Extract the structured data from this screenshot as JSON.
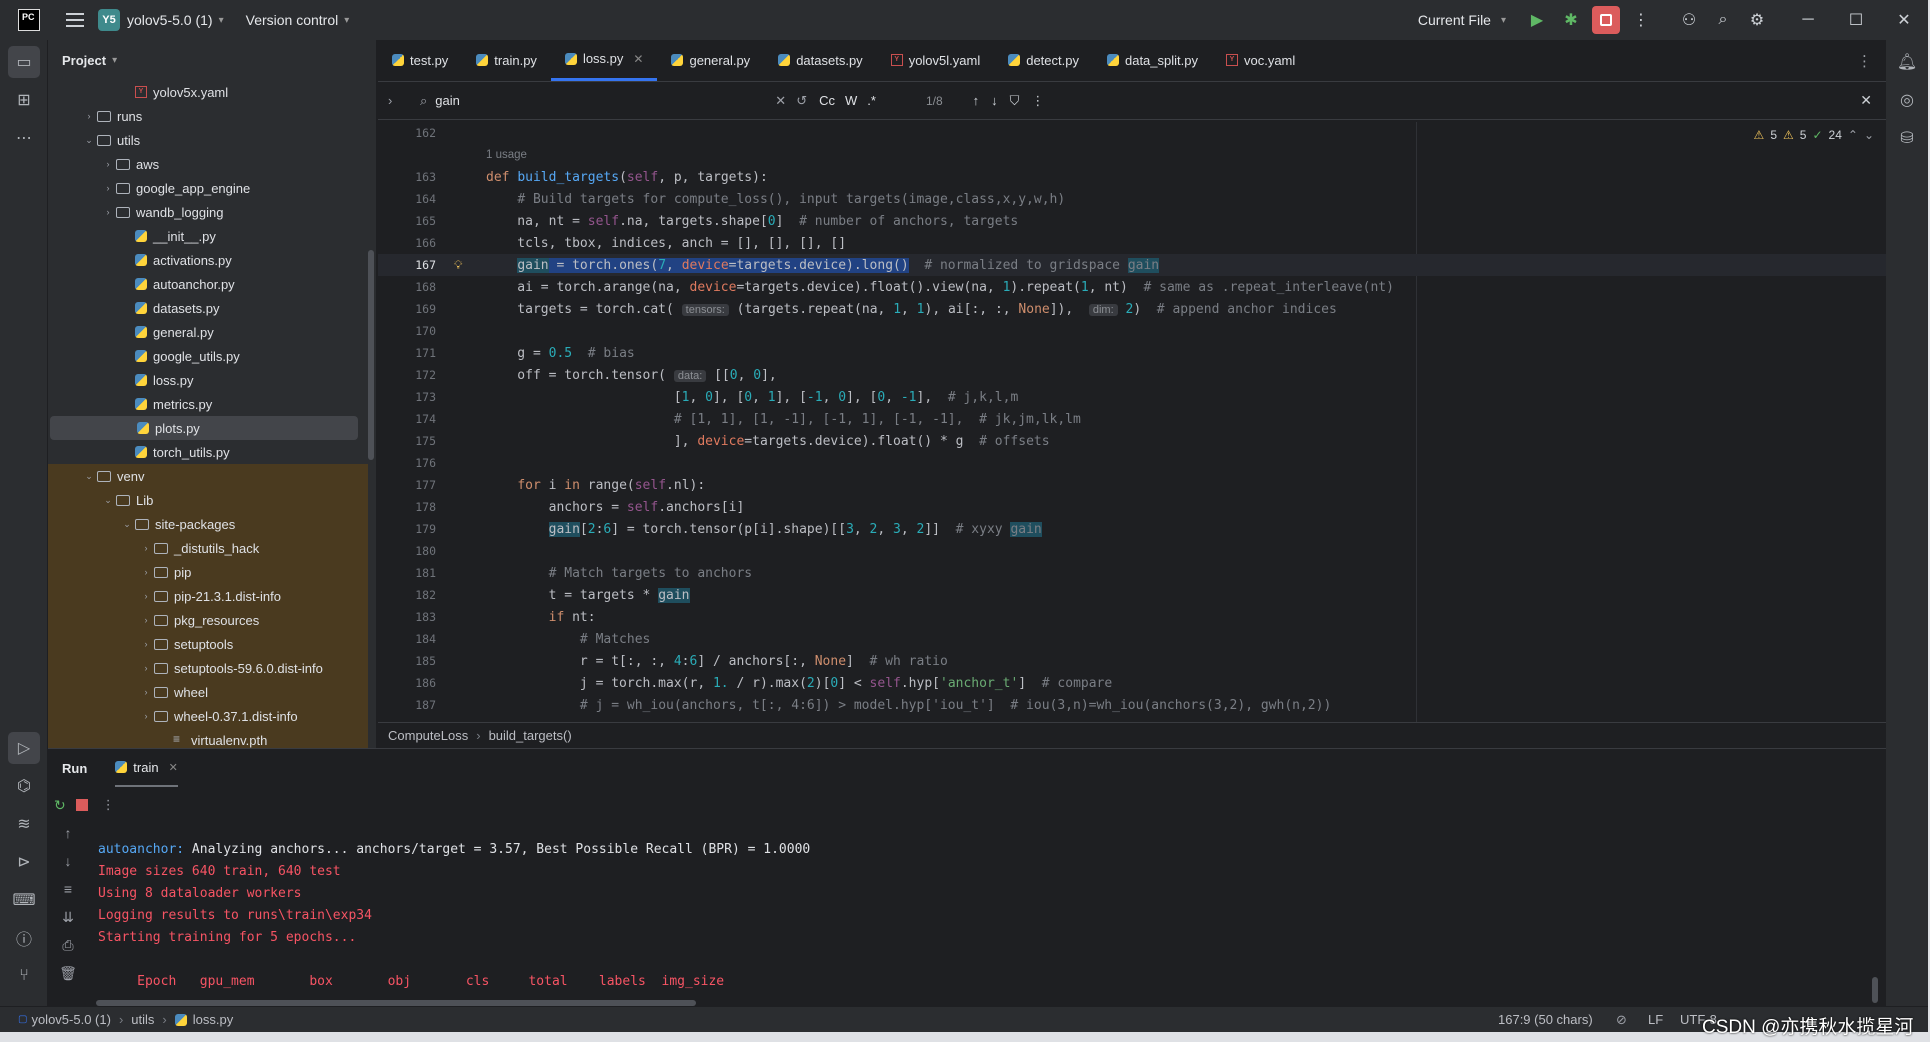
{
  "titlebar": {
    "app_logo": "PC",
    "project_badge": "Y5",
    "project_name": "yolov5-5.0 (1)",
    "version_control": "Version control",
    "run_config": "Current File"
  },
  "project_panel": {
    "title": "Project",
    "tree": [
      {
        "label": "yolov5x.yaml",
        "kind": "yaml",
        "depth": 3
      },
      {
        "label": "runs",
        "kind": "folder",
        "depth": 1,
        "arrow": "right"
      },
      {
        "label": "utils",
        "kind": "folder",
        "depth": 1,
        "arrow": "down"
      },
      {
        "label": "aws",
        "kind": "folder",
        "depth": 2,
        "arrow": "right"
      },
      {
        "label": "google_app_engine",
        "kind": "folder",
        "depth": 2,
        "arrow": "right"
      },
      {
        "label": "wandb_logging",
        "kind": "folder",
        "depth": 2,
        "arrow": "right"
      },
      {
        "label": "__init__.py",
        "kind": "py",
        "depth": 3
      },
      {
        "label": "activations.py",
        "kind": "py",
        "depth": 3
      },
      {
        "label": "autoanchor.py",
        "kind": "py",
        "depth": 3
      },
      {
        "label": "datasets.py",
        "kind": "py",
        "depth": 3
      },
      {
        "label": "general.py",
        "kind": "py",
        "depth": 3
      },
      {
        "label": "google_utils.py",
        "kind": "py",
        "depth": 3
      },
      {
        "label": "loss.py",
        "kind": "py",
        "depth": 3
      },
      {
        "label": "metrics.py",
        "kind": "py",
        "depth": 3
      },
      {
        "label": "plots.py",
        "kind": "py",
        "depth": 3,
        "selected": true
      },
      {
        "label": "torch_utils.py",
        "kind": "py",
        "depth": 3
      },
      {
        "label": "venv",
        "kind": "folder",
        "depth": 1,
        "arrow": "down",
        "venv": true
      },
      {
        "label": "Lib",
        "kind": "folder",
        "depth": 2,
        "arrow": "down",
        "venv": true
      },
      {
        "label": "site-packages",
        "kind": "folder",
        "depth": 3,
        "arrow": "down",
        "venv": true
      },
      {
        "label": "_distutils_hack",
        "kind": "folder",
        "depth": 4,
        "arrow": "right",
        "venv": true
      },
      {
        "label": "pip",
        "kind": "folder",
        "depth": 4,
        "arrow": "right",
        "venv": true
      },
      {
        "label": "pip-21.3.1.dist-info",
        "kind": "folder",
        "depth": 4,
        "arrow": "right",
        "venv": true
      },
      {
        "label": "pkg_resources",
        "kind": "folder",
        "depth": 4,
        "arrow": "right",
        "venv": true
      },
      {
        "label": "setuptools",
        "kind": "folder",
        "depth": 4,
        "arrow": "right",
        "venv": true
      },
      {
        "label": "setuptools-59.6.0.dist-info",
        "kind": "folder",
        "depth": 4,
        "arrow": "right",
        "venv": true
      },
      {
        "label": "wheel",
        "kind": "folder",
        "depth": 4,
        "arrow": "right",
        "venv": true
      },
      {
        "label": "wheel-0.37.1.dist-info",
        "kind": "folder",
        "depth": 4,
        "arrow": "right",
        "venv": true
      },
      {
        "label": "virtualenv.pth",
        "kind": "txt",
        "depth": 5,
        "venv": true
      }
    ]
  },
  "tabs": [
    {
      "label": "test.py",
      "kind": "py"
    },
    {
      "label": "train.py",
      "kind": "py"
    },
    {
      "label": "loss.py",
      "kind": "py",
      "active": true
    },
    {
      "label": "general.py",
      "kind": "py"
    },
    {
      "label": "datasets.py",
      "kind": "py"
    },
    {
      "label": "yolov5l.yaml",
      "kind": "yaml"
    },
    {
      "label": "detect.py",
      "kind": "py"
    },
    {
      "label": "data_split.py",
      "kind": "py"
    },
    {
      "label": "voc.yaml",
      "kind": "yaml"
    }
  ],
  "search": {
    "query": "gain",
    "match_count": "1/8",
    "case_label": "Cc",
    "word_label": "W",
    "regex_label": ".*"
  },
  "inspections": {
    "warnings_a": "5",
    "warnings_b": "5",
    "ok": "24"
  },
  "code": {
    "usage_hint": "1 usage",
    "current_line": "167",
    "lines": [
      {
        "n": "162",
        "html": ""
      },
      {
        "n": "163",
        "html": "<span class='kw'>def </span><span class='fn'>build_targets</span>(<span class='sf'>self</span>, p, targets):"
      },
      {
        "n": "164",
        "html": "    <span class='cm'># Build targets for compute_loss(), input targets(image,class,x,y,w,h)</span>"
      },
      {
        "n": "165",
        "html": "    na, nt = <span class='sf'>self</span>.na, targets.shape[<span class='nu'>0</span>]  <span class='cm'># number of anchors, targets</span>"
      },
      {
        "n": "166",
        "html": "    tcls, tbox, indices, anch = [], [], [], []"
      },
      {
        "n": "167",
        "html": "    <span class='sel2'><span class='hl'>gain</span> = torch.ones(<span class='nu'>7</span>, <span class='pa'>device</span>=targets.device).long()</span>  <span class='cm'># normalized to gridspace </span><span class='hl cm'>gain</span>"
      },
      {
        "n": "168",
        "html": "    ai = torch.arange(na, <span class='pa'>device</span>=targets.device).float().view(na, <span class='nu'>1</span>).repeat(<span class='nu'>1</span>, nt)  <span class='cm'># same as .repeat_interleave(nt)</span>"
      },
      {
        "n": "169",
        "html": "    targets = torch.cat( <span class='hint'>tensors:</span> (targets.repeat(na, <span class='nu'>1</span>, <span class='nu'>1</span>), ai[:, :, <span class='kw'>None</span>]),  <span class='hint'>dim:</span> <span class='nu'>2</span>)  <span class='cm'># append anchor indices</span>"
      },
      {
        "n": "170",
        "html": ""
      },
      {
        "n": "171",
        "html": "    g = <span class='nu'>0.5</span>  <span class='cm'># bias</span>"
      },
      {
        "n": "172",
        "html": "    off = torch.tensor( <span class='hint'>data:</span> [[<span class='nu'>0</span>, <span class='nu'>0</span>],"
      },
      {
        "n": "173",
        "html": "                        [<span class='nu'>1</span>, <span class='nu'>0</span>], [<span class='nu'>0</span>, <span class='nu'>1</span>], [<span class='nu'>-1</span>, <span class='nu'>0</span>], [<span class='nu'>0</span>, <span class='nu'>-1</span>],  <span class='cm'># j,k,l,m</span>"
      },
      {
        "n": "174",
        "html": "                        <span class='cm'># [1, 1], [1, -1], [-1, 1], [-1, -1],  # jk,jm,lk,lm</span>"
      },
      {
        "n": "175",
        "html": "                        ], <span class='pa'>device</span>=targets.device).float() * g  <span class='cm'># offsets</span>"
      },
      {
        "n": "176",
        "html": ""
      },
      {
        "n": "177",
        "html": "    <span class='kw'>for </span>i <span class='kw'>in </span>range(<span class='sf'>self</span>.nl):"
      },
      {
        "n": "178",
        "html": "        anchors = <span class='sf'>self</span>.anchors[i]"
      },
      {
        "n": "179",
        "html": "        <span class='hl'>gain</span>[<span class='nu'>2</span>:<span class='nu'>6</span>] = torch.tensor(p[i].shape)[[<span class='nu'>3</span>, <span class='nu'>2</span>, <span class='nu'>3</span>, <span class='nu'>2</span>]]  <span class='cm'># xyxy </span><span class='hl cm'>gain</span>"
      },
      {
        "n": "180",
        "html": ""
      },
      {
        "n": "181",
        "html": "        <span class='cm'># Match targets to anchors</span>"
      },
      {
        "n": "182",
        "html": "        t = targets * <span class='hl'>gain</span>"
      },
      {
        "n": "183",
        "html": "        <span class='kw'>if </span>nt:"
      },
      {
        "n": "184",
        "html": "            <span class='cm'># Matches</span>"
      },
      {
        "n": "185",
        "html": "            r = t[:, :, <span class='nu'>4</span>:<span class='nu'>6</span>] / anchors[:, <span class='kw'>None</span>]  <span class='cm'># wh ratio</span>"
      },
      {
        "n": "186",
        "html": "            j = torch.max(r, <span class='nu'>1.</span> / r).max(<span class='nu'>2</span>)[<span class='nu'>0</span>] &lt; <span class='sf'>self</span>.hyp[<span class='st'>'anchor_t'</span>]  <span class='cm'># compare</span>"
      },
      {
        "n": "187",
        "html": "            <span class='cm'># j = wh_iou(anchors, t[:, 4:6]) &gt; model.hyp['iou_t']  # iou(3,n)=wh_iou(anchors(3,2), gwh(n,2))</span>"
      }
    ]
  },
  "breadcrumb": {
    "cls": "ComputeLoss",
    "method": "build_targets()"
  },
  "run": {
    "title": "Run",
    "tab": "train",
    "output": [
      {
        "cls": "blue",
        "prefix": "autoanchor: ",
        "text": "Analyzing anchors... anchors/target = 3.57, Best Possible Recall (BPR) = 1.0000"
      },
      {
        "cls": "red",
        "prefix": "",
        "text": "Image sizes 640 train, 640 test"
      },
      {
        "cls": "red",
        "prefix": "",
        "text": "Using 8 dataloader workers"
      },
      {
        "cls": "red",
        "prefix": "",
        "text": "Logging results to runs\\train\\exp34"
      },
      {
        "cls": "red",
        "prefix": "",
        "text": "Starting training for 5 epochs..."
      },
      {
        "cls": "red",
        "prefix": "",
        "text": ""
      },
      {
        "cls": "red",
        "prefix": "",
        "text": "     Epoch   gpu_mem       box       obj       cls     total    labels  img_size"
      }
    ]
  },
  "statusbar": {
    "project": "yolov5-5.0 (1)",
    "folder": "utils",
    "file": "loss.py",
    "position": "167:9 (50 chars)",
    "line_sep": "LF",
    "encoding": "UTF-8",
    "watermark": "CSDN @亦携秋水揽星河"
  }
}
